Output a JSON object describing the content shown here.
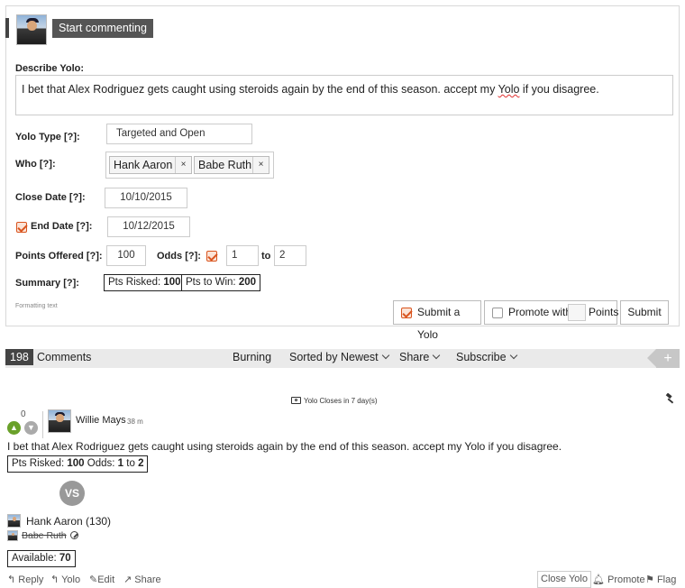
{
  "composer": {
    "start_button": "Start commenting",
    "describe_label": "Describe Yolo:",
    "description_before": "I bet that Alex Rodriguez gets caught using steroids again by the end of this season. accept my ",
    "description_flagged": "Yolo",
    "description_after": " if you disagree.",
    "yolo_type_label": "Yolo Type",
    "help_marker": "[?]",
    "colon": ":",
    "yolo_type_value": "Targeted and Open",
    "who_label": "Who",
    "who_tags": [
      "Hank Aaron",
      "Babe Ruth"
    ],
    "remove_glyph": "×",
    "close_date_label": "Close Date",
    "close_date_value": "10/10/2015",
    "end_date_label": "End Date",
    "end_date_value": "10/12/2015",
    "end_date_checked": true,
    "points_offered_label": "Points Offered",
    "points_offered_value": "100",
    "odds_label": "Odds",
    "odds_checked": true,
    "odds_from": "1",
    "odds_to_word": "to",
    "odds_to": "2",
    "summary_label": "Summary",
    "pts_risked_label": "Pts Risked:",
    "pts_risked_value": "100",
    "pts_to_win_label": "Pts to Win:",
    "pts_to_win_value": "200",
    "formatting_text": "Formatting text",
    "submit_yolo_label": "Submit a Yolo",
    "submit_yolo_checked": true,
    "promote_label": "Promote with",
    "promote_points_value": "",
    "points_label": "Points",
    "submit_button": "Submit"
  },
  "comments_bar": {
    "count": "198",
    "comments_label": "Comments",
    "burning": "Burning",
    "sorted": "Sorted by Newest",
    "share": "Share",
    "subscribe": "Subscribe",
    "plus": "+"
  },
  "comment": {
    "closes_notice": "Yolo Closes in 7 day(s)",
    "score": "0",
    "author": "Willie Mays",
    "age": "38 m",
    "text": "I bet that Alex Rodriguez gets caught using steroids again by the end of this season. accept my Yolo if you disagree.",
    "pts_risked_label": "Pts Risked:",
    "pts_risked_value": "100",
    "odds_label": "Odds:",
    "odds_from": "1",
    "odds_to_word": "to",
    "odds_to": "2",
    "vs": "VS",
    "opponent_1": "Hank Aaron (130)",
    "opponent_2": "Babe Ruth",
    "available_label": "Available:",
    "available_value": "70",
    "actions": {
      "reply": "Reply",
      "yolo": "Yolo",
      "edit": "Edit",
      "share": "Share",
      "close_yolo": "Close Yolo",
      "promote": "Promote",
      "flag": "Flag"
    }
  },
  "colors": {
    "accent_orange": "#d9541e",
    "upvote_green": "#6aa12a",
    "dark_label_bg": "#555555",
    "bar_bg": "#eaeaea"
  },
  "icons": [
    "user-avatar",
    "close-x-icon",
    "checkbox-checked-icon",
    "chevron-down-icon",
    "plus-icon",
    "camera-icon",
    "gavel-icon",
    "upvote-icon",
    "downvote-icon",
    "ban-icon",
    "reply-icon",
    "edit-icon",
    "share-icon",
    "bell-icon",
    "flag-icon"
  ]
}
